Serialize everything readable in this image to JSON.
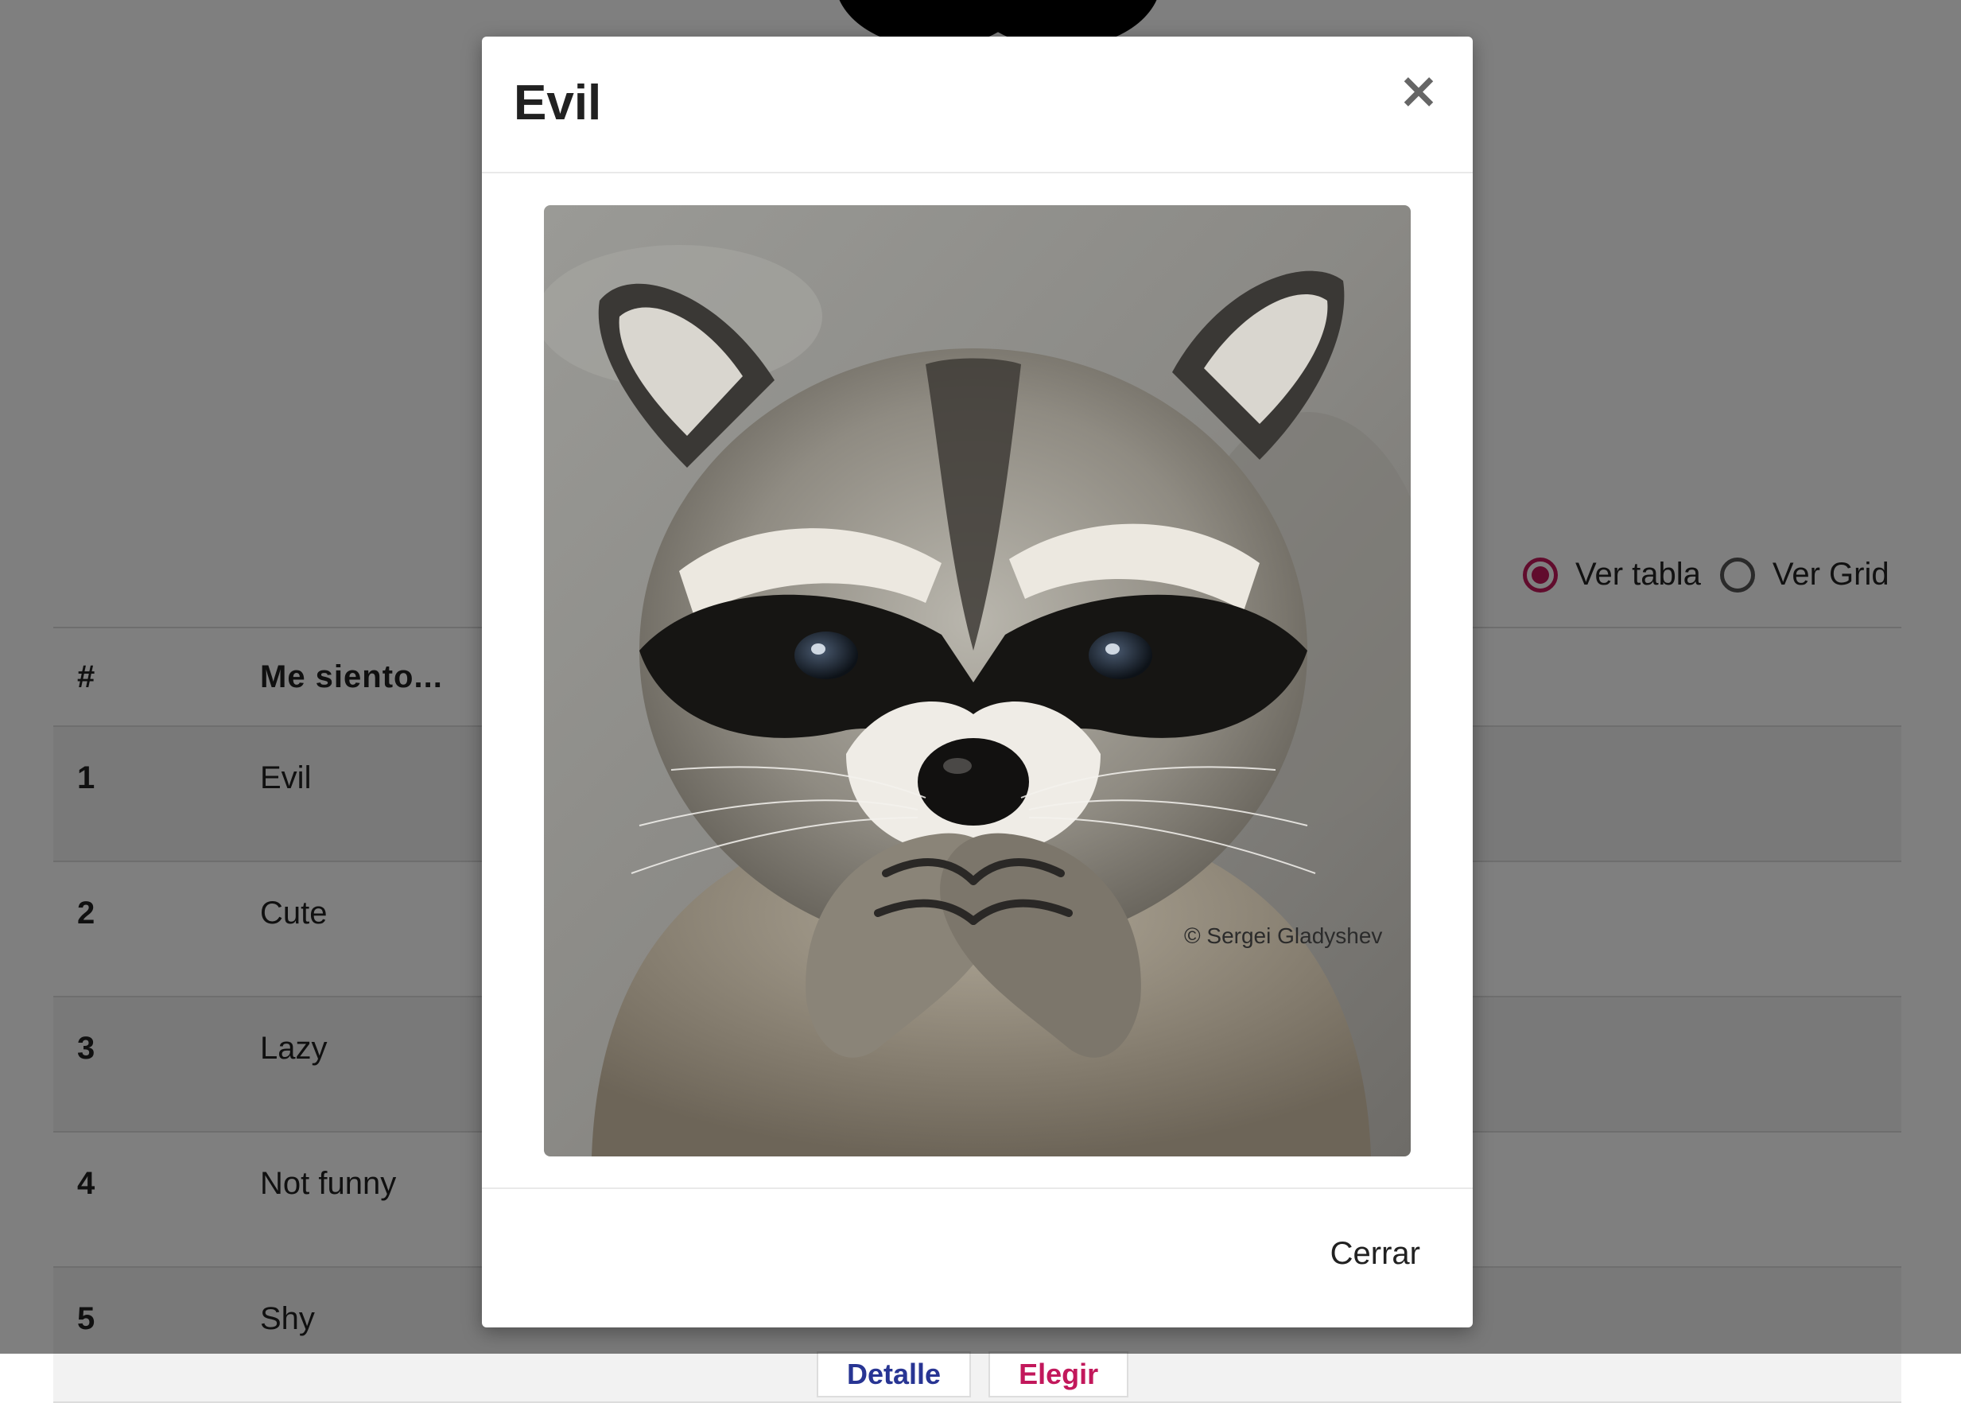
{
  "view_toggle": {
    "table_label": "Ver tabla",
    "grid_label": "Ver Grid",
    "selected": "table"
  },
  "table": {
    "headers": [
      "#",
      "Me siento..."
    ],
    "rows": [
      {
        "num": "1",
        "label": "Evil"
      },
      {
        "num": "2",
        "label": "Cute"
      },
      {
        "num": "3",
        "label": "Lazy"
      },
      {
        "num": "4",
        "label": "Not funny"
      },
      {
        "num": "5",
        "label": "Shy"
      }
    ],
    "detail_button": "Detalle",
    "choose_button": "Elegir"
  },
  "modal": {
    "title": "Evil",
    "close_icon": "×",
    "close_label": "Cerrar",
    "image_credit": "© Sergei Gladyshev"
  },
  "colors": {
    "accent": "#c2185b",
    "detail": "#283593"
  },
  "icons": {
    "close": "close-icon"
  }
}
